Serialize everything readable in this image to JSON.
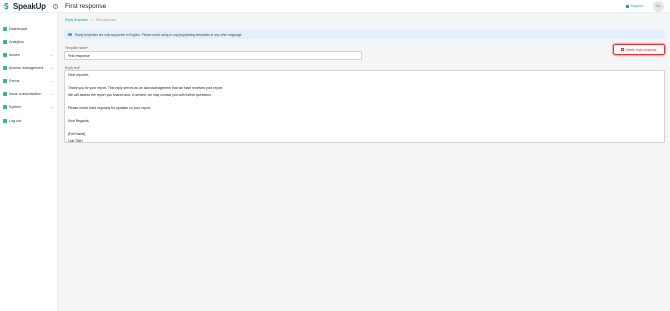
{
  "app": {
    "brand": "SpeakUp",
    "page_title": "First response"
  },
  "header": {
    "support_label": "Support",
    "avatar_initials": "LL",
    "accent_color": "#1aa37a"
  },
  "sidebar": {
    "items": [
      {
        "label": "Dashboard",
        "icon": "dashboard-icon",
        "chevron": false
      },
      {
        "label": "Analytics",
        "icon": "analytics-icon",
        "chevron": false
      },
      {
        "label": "Issues",
        "icon": "issues-icon",
        "chevron": true
      },
      {
        "label": "Access management",
        "icon": "access-icon",
        "chevron": true
      },
      {
        "label": "Forms",
        "icon": "forms-icon",
        "chevron": true
      },
      {
        "label": "Issue customisation",
        "icon": "customisation-icon",
        "chevron": true
      },
      {
        "label": "System",
        "icon": "system-icon",
        "chevron": true
      },
      {
        "label": "Log out",
        "icon": "logout-icon",
        "chevron": false
      }
    ]
  },
  "breadcrumb": {
    "parent": "Reply templates",
    "separator": ">",
    "current": "First response"
  },
  "banner": {
    "text": "Reply templates are only supported in English. Please avoid using or copying/pasting templates in any other language."
  },
  "form": {
    "name_label": "Template name*",
    "name_value": "First response",
    "text_label": "Reply text*",
    "reply_lines": [
      "Dear reporter,",
      "",
      "Thank you for your report. This reply serves as an acknowledgement that we have received your report.",
      "We will assess the report you shared and, if needed, we may contact you with further questions.",
      "",
      "Please check back regularly for updates on your report.",
      "",
      "Kind Regards,",
      "",
      "[Full Name]",
      "[Job Title]"
    ]
  },
  "actions": {
    "delete_label": "Delete reply template",
    "danger_color": "#dd3333"
  }
}
